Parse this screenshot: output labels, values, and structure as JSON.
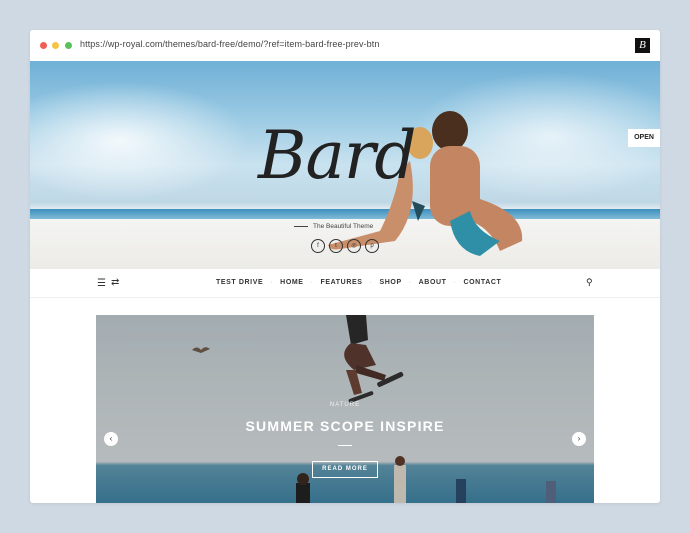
{
  "browser": {
    "url": "https://wp-royal.com/themes/bard-free/demo/?ref=item-bard-free-prev-btn",
    "tab_icon_letter": "B"
  },
  "hero": {
    "logo": "Bard",
    "tagline": "The Beautiful Theme",
    "social_icons": [
      "facebook-icon",
      "twitter-icon",
      "instagram-icon",
      "pinterest-icon"
    ],
    "open_label": "OPEN"
  },
  "nav": {
    "items": [
      "TEST DRIVE",
      "HOME",
      "FEATURES",
      "SHOP",
      "ABOUT",
      "CONTACT"
    ],
    "separator": "·"
  },
  "slider": {
    "category": "NATURE",
    "title": "SUMMER SCOPE INSPIRE",
    "read_more": "READ MORE"
  },
  "colors": {
    "background": "#cfd9e3",
    "dot_red": "#f25c54",
    "dot_yellow": "#f6c344",
    "dot_green": "#5ac05a"
  }
}
